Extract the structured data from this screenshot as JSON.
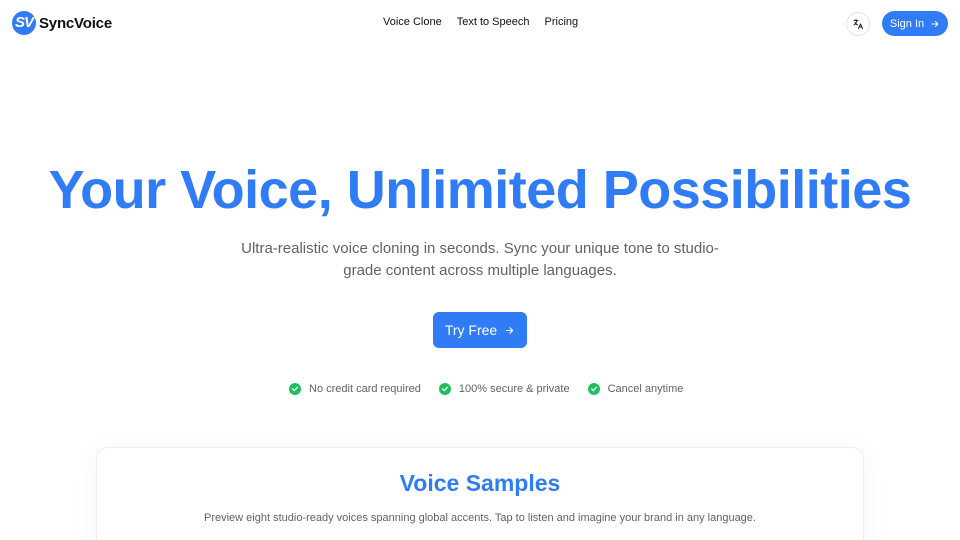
{
  "brand": {
    "logo_mark": "SV",
    "name": "SyncVoice",
    "color": "#2f7cf6"
  },
  "nav": {
    "links": [
      "Voice Clone",
      "Text to Speech",
      "Pricing"
    ],
    "language_icon": "translate-icon",
    "signin_label": "Sign In"
  },
  "hero": {
    "title": "Your Voice, Unlimited Possibilities",
    "subtitle": "Ultra-realistic voice cloning in seconds. Sync your unique tone to studio-grade content across multiple languages.",
    "cta_label": "Try Free",
    "features": [
      "No credit card required",
      "100% secure & private",
      "Cancel anytime"
    ],
    "check_color": "#1fbf5f"
  },
  "samples": {
    "title": "Voice Samples",
    "subtitle": "Preview eight studio-ready voices spanning global accents. Tap to listen and imagine your brand in any language."
  }
}
